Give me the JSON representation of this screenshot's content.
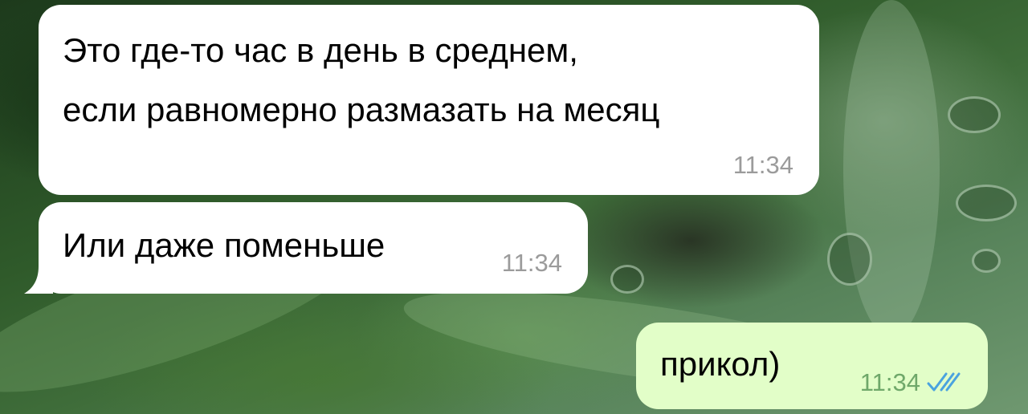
{
  "messages": [
    {
      "direction": "incoming",
      "line1": "Это где-то час в день в среднем,",
      "line2": "если равномерно размазать на месяц",
      "time": "11:34"
    },
    {
      "direction": "incoming",
      "text": "Или даже поменьше",
      "time": "11:34"
    },
    {
      "direction": "outgoing",
      "text": "прикол)",
      "time": "11:34",
      "status_icon": "double-check-icon"
    }
  ],
  "colors": {
    "incoming_bubble": "#ffffff",
    "outgoing_bubble": "#e2fec8",
    "timestamp_incoming": "#9b9b9b",
    "timestamp_outgoing": "#6fa86a",
    "read_checks": "#4aa3df"
  }
}
